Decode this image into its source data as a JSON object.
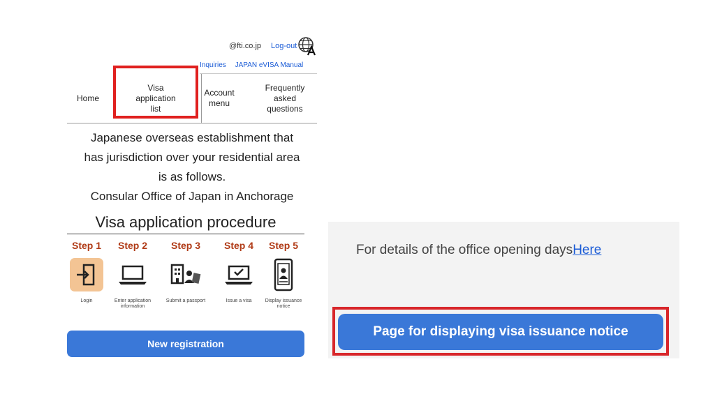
{
  "header": {
    "email": "@fti.co.jp",
    "logout_label": "Log-out",
    "sub_links": [
      "Inquiries",
      "JAPAN eVISA Manual"
    ]
  },
  "nav": {
    "items": [
      {
        "key": "home",
        "label": "Home"
      },
      {
        "key": "visa",
        "label": "Visa\napplication\nlist"
      },
      {
        "key": "account",
        "label": "Account\nmenu"
      },
      {
        "key": "faq",
        "label": "Frequently\nasked\nquestions"
      }
    ]
  },
  "info": {
    "lines": [
      "Japanese overseas establishment that",
      "has jurisdiction over your residential area",
      "is as follows.",
      "Consular Office of Japan in Anchorage"
    ]
  },
  "procedure": {
    "title": "Visa application procedure",
    "steps": [
      {
        "label": "Step 1",
        "caption": "Login",
        "icon": "login-icon"
      },
      {
        "label": "Step 2",
        "caption": "Enter application information",
        "icon": "laptop-icon"
      },
      {
        "label": "Step 3",
        "caption": "Submit a passport",
        "icon": "passport-icon"
      },
      {
        "label": "Step 4",
        "caption": "Issue a visa",
        "icon": "laptop-check-icon"
      },
      {
        "label": "Step 5",
        "caption": "Display issuance notice",
        "icon": "phone-icon"
      }
    ],
    "new_registration_label": "New registration"
  },
  "right": {
    "office_text": "For details of the office opening days",
    "here_link": "Here",
    "notice_button_label": "Page for displaying visa issuance notice"
  },
  "colors": {
    "accent": "#3a78d8",
    "highlight": "#e0201f",
    "step_label": "#b03a16"
  }
}
